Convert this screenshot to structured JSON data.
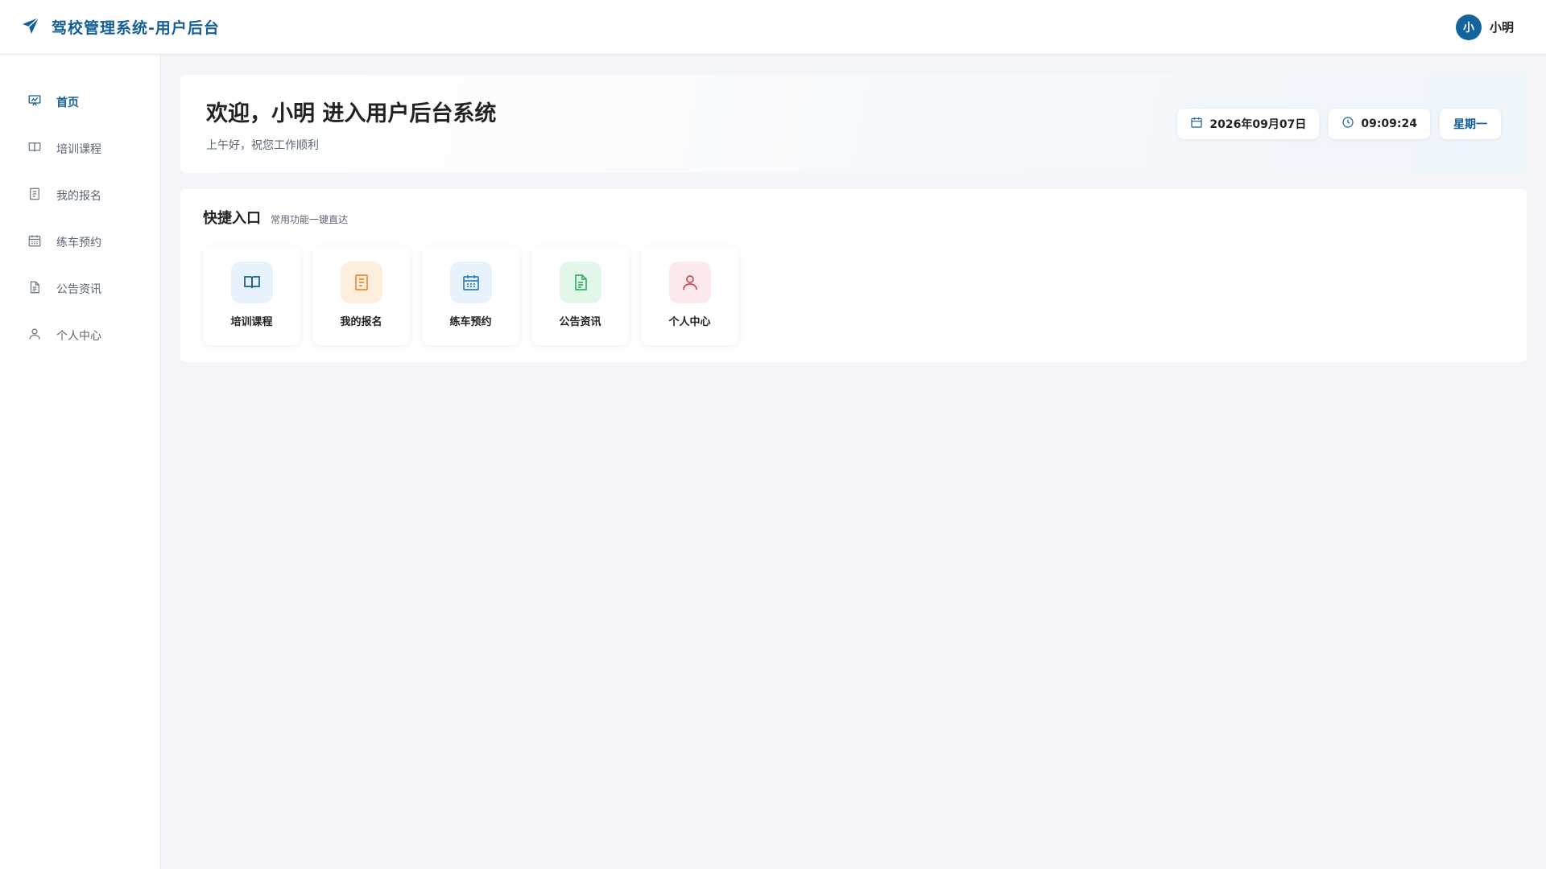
{
  "header": {
    "title": "驾校管理系统-用户后台",
    "logo_icon": "paper-plane-icon",
    "user": {
      "avatar_text": "小",
      "name": "小明"
    }
  },
  "colors": {
    "primary": "#135f97",
    "blue_bg": "#e8f2fc",
    "orange": "#f08c2e",
    "orange_bg": "#fdeedd",
    "blue": "#2f7dc0",
    "green": "#32b36a",
    "green_bg": "#e3f6ea",
    "red": "#c94a4a",
    "red_bg": "#fbe9ec"
  },
  "sidebar": {
    "items": [
      {
        "label": "首页",
        "icon": "dashboard-icon",
        "active": true
      },
      {
        "label": "培训课程",
        "icon": "book-icon",
        "active": false
      },
      {
        "label": "我的报名",
        "icon": "document-list-icon",
        "active": false
      },
      {
        "label": "练车预约",
        "icon": "calendar-icon",
        "active": false
      },
      {
        "label": "公告资讯",
        "icon": "file-text-icon",
        "active": false
      },
      {
        "label": "个人中心",
        "icon": "user-icon",
        "active": false
      }
    ]
  },
  "welcome": {
    "title": "欢迎，小明 进入用户后台系统",
    "subtitle": "上午好，祝您工作顺利",
    "date": "2026年09月07日",
    "time": "09:09:24",
    "weekday": "星期一"
  },
  "quick": {
    "title": "快捷入口",
    "subtitle": "常用功能一键直达",
    "cards": [
      {
        "label": "培训课程",
        "icon": "book-icon"
      },
      {
        "label": "我的报名",
        "icon": "document-list-icon"
      },
      {
        "label": "练车预约",
        "icon": "calendar-icon"
      },
      {
        "label": "公告资讯",
        "icon": "file-text-icon"
      },
      {
        "label": "个人中心",
        "icon": "user-icon"
      }
    ]
  }
}
